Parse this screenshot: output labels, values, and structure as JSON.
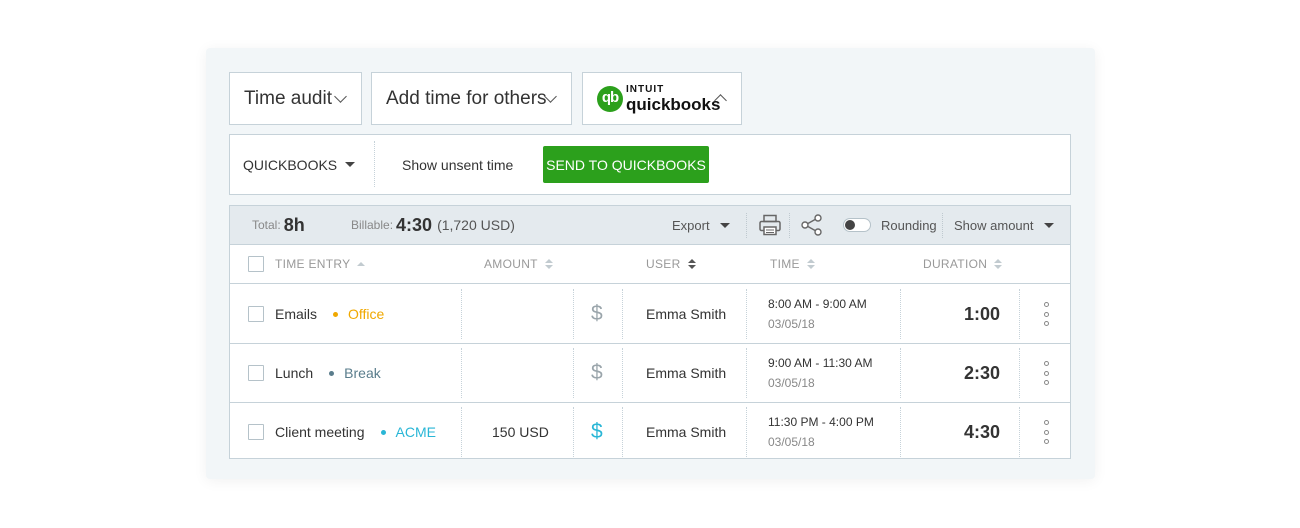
{
  "top_dropdowns": {
    "time_audit": "Time audit",
    "add_time": "Add time for others",
    "quickbooks": {
      "brand_top": "INTUIT",
      "brand_name": "quickbooks",
      "logo_text": "qb"
    }
  },
  "integration_bar": {
    "selector": "QUICKBOOKS",
    "show_unsent": "Show unsent time",
    "send_button": "SEND TO QUICKBOOKS"
  },
  "summary": {
    "total_label": "Total:",
    "total_value": "8h",
    "billable_label": "Billable:",
    "billable_value": "4:30",
    "billable_amount": "(1,720 USD)",
    "export": "Export",
    "rounding": "Rounding",
    "show_amount": "Show amount"
  },
  "columns": {
    "time_entry": "TIME ENTRY",
    "amount": "AMOUNT",
    "user": "USER",
    "time": "TIME",
    "duration": "DURATION"
  },
  "entries": [
    {
      "description": "Emails",
      "project": "Office",
      "project_color": "#f0a800",
      "amount": "",
      "billable": false,
      "user": "Emma Smith",
      "time_range": "8:00 AM - 9:00 AM",
      "date": "03/05/18",
      "duration": "1:00"
    },
    {
      "description": "Lunch",
      "project": "Break",
      "project_color": "#5a7d8c",
      "amount": "",
      "billable": false,
      "user": "Emma Smith",
      "time_range": "9:00 AM - 11:30 AM",
      "date": "03/05/18",
      "duration": "2:30"
    },
    {
      "description": "Client meeting",
      "project": "ACME",
      "project_color": "#29b6d6",
      "amount": "150 USD",
      "billable": true,
      "user": "Emma Smith",
      "time_range": "11:30 PM - 4:00 PM",
      "date": "03/05/18",
      "duration": "4:30"
    }
  ],
  "dollar_symbol": "$",
  "colors": {
    "accent_green": "#2ca01c",
    "billable_blue": "#29b6d6",
    "nonbillable_gray": "#9aa5ab"
  }
}
